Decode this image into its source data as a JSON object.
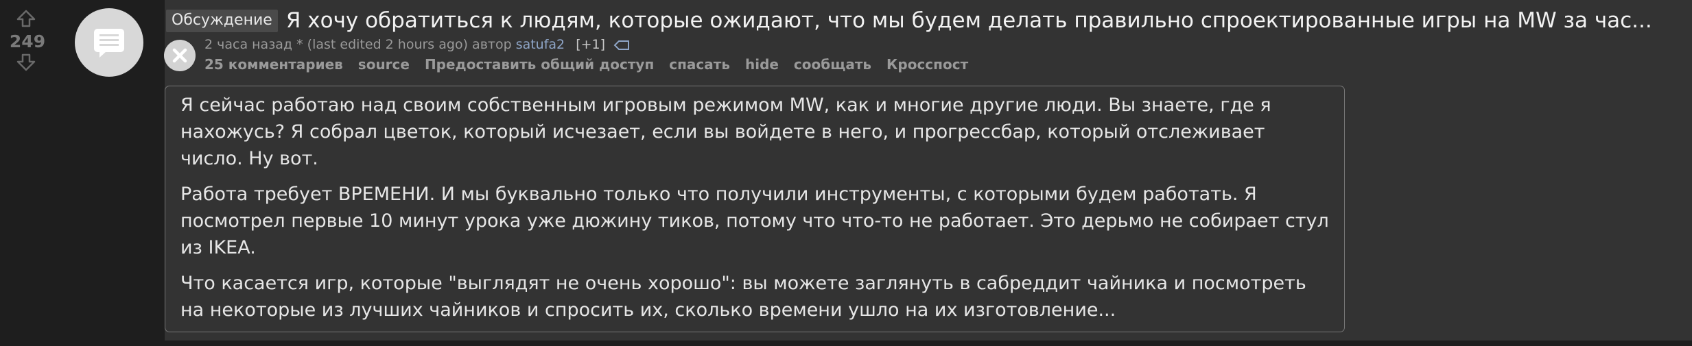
{
  "vote": {
    "score": "249"
  },
  "post": {
    "flair": "Обсуждение",
    "title": "Я хочу обратиться к людям, которые ожидают, что мы будем делать правильно спроектированные игры на MW за час...",
    "time": "2 часа назад",
    "edited_mark": "*",
    "edited_text": "(last edited 2 hours ago)",
    "author_prefix": "автор",
    "author": "satufa2",
    "flair_count": "[+1]"
  },
  "actions": {
    "comments": "25 комментариев",
    "source": "source",
    "share": "Предоставить общий доступ",
    "save": "спасать",
    "hide": "hide",
    "report": "сообщать",
    "crosspost": "Кросспост"
  },
  "selftext": {
    "paragraphs": [
      "Я сейчас работаю над своим собственным игровым режимом MW, как и многие другие люди. Вы знаете, где я нахожусь? Я собрал цветок, который исчезает, если вы войдете в него, и прогрессбар, который отслеживает число. Ну вот.",
      "Работа требует ВРЕМЕНИ. И мы буквально только что получили инструменты, с которыми будем работать. Я посмотрел первые 10 минут урока уже дюжину тиков, потому что что-то не работает. Это дерьмо не собирает стул из IKEA.",
      "Что касается игр, которые \"выглядят не очень хорошо\": вы можете заглянуть в сабреддит чайника и посмотреть на некоторые из лучших чайников и спросить их, сколько времени ушло на их изготовление..."
    ]
  },
  "icons": {
    "upvote": "upvote-arrow-icon",
    "downvote": "downvote-arrow-icon",
    "thumbnail": "text-post-icon",
    "close": "close-icon",
    "tag": "tag-icon"
  },
  "colors": {
    "background": "#1e1e1e",
    "post_background": "#333333",
    "author_link": "#8fa6c8",
    "score": "#7a7a7a"
  }
}
